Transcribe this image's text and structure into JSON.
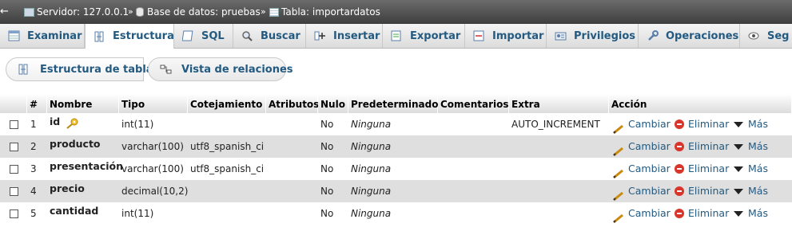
{
  "breadcrumb": {
    "back": "←",
    "server": "Servidor: 127.0.0.1",
    "sep1": "»",
    "database": "Base de datos: pruebas",
    "sep2": "»",
    "table": "Tabla: importardatos"
  },
  "tabs": [
    {
      "label": "Examinar",
      "icon": "browse-icon",
      "active": false
    },
    {
      "label": "Estructura",
      "icon": "structure-icon",
      "active": true
    },
    {
      "label": "SQL",
      "icon": "sql-icon",
      "active": false
    },
    {
      "label": "Buscar",
      "icon": "search-icon",
      "active": false
    },
    {
      "label": "Insertar",
      "icon": "insert-icon",
      "active": false
    },
    {
      "label": "Exportar",
      "icon": "export-icon",
      "active": false
    },
    {
      "label": "Importar",
      "icon": "import-icon",
      "active": false
    },
    {
      "label": "Privilegios",
      "icon": "privileges-icon",
      "active": false
    },
    {
      "label": "Operaciones",
      "icon": "operations-icon",
      "active": false
    },
    {
      "label": "Seg",
      "icon": "tracking-icon",
      "active": false
    }
  ],
  "subtabs": {
    "table_structure": "Estructura de tabla",
    "relation_view": "Vista de relaciones"
  },
  "columns": [
    "#",
    "Nombre",
    "Tipo",
    "Cotejamiento",
    "Atributos",
    "Nulo",
    "Predeterminado",
    "Comentarios",
    "Extra",
    "Acción"
  ],
  "rows": [
    {
      "num": "1",
      "name": "id",
      "type": "int(11)",
      "collation": "",
      "attributes": "",
      "null": "No",
      "default": "Ninguna",
      "comments": "",
      "extra": "AUTO_INCREMENT",
      "primary_key": true
    },
    {
      "num": "2",
      "name": "producto",
      "type": "varchar(100)",
      "collation": "utf8_spanish_ci",
      "attributes": "",
      "null": "No",
      "default": "Ninguna",
      "comments": "",
      "extra": "",
      "primary_key": false
    },
    {
      "num": "3",
      "name": "presentación",
      "type": "varchar(100)",
      "collation": "utf8_spanish_ci",
      "attributes": "",
      "null": "No",
      "default": "Ninguna",
      "comments": "",
      "extra": "",
      "primary_key": false
    },
    {
      "num": "4",
      "name": "precio",
      "type": "decimal(10,2)",
      "collation": "",
      "attributes": "",
      "null": "No",
      "default": "Ninguna",
      "comments": "",
      "extra": "",
      "primary_key": false
    },
    {
      "num": "5",
      "name": "cantidad",
      "type": "int(11)",
      "collation": "",
      "attributes": "",
      "null": "No",
      "default": "Ninguna",
      "comments": "",
      "extra": "",
      "primary_key": false
    }
  ],
  "actions": {
    "change": "Cambiar",
    "drop": "Eliminar",
    "more": "Más"
  },
  "colors": {
    "link": "#235a81",
    "row_alt": "#dfdfdf",
    "header_bar": "#4a4a4a",
    "delete": "#d9352a"
  }
}
